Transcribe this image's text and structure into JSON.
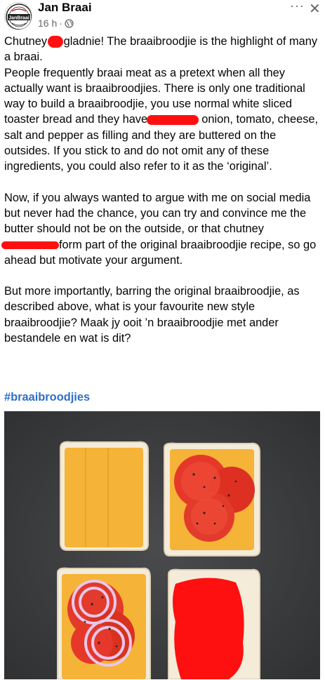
{
  "header": {
    "author": "Jan Braai",
    "time": "16 h",
    "separator": "·",
    "logo_text": "JanBraai",
    "more_icon": "more-dots-icon",
    "close_icon": "close-icon",
    "privacy_icon": "globe-icon"
  },
  "post": {
    "line1_a": "Chutney ",
    "line1_b": "gladnie! The braaibroodjie is the highlight of many a braai.",
    "line2": "People frequently braai meat as a pretext when all they actually want is braaibroodjies. There is only one traditional way to build a braaibroodjie, you use normal white sliced toaster bread and they have ",
    "line2_b": " onion, tomato, cheese, salt and pepper as filling and they are buttered on the outsides. If you stick to and do not omit any of these ingredients, you could also refer to it as the ‘original’.",
    "para2_a": "Now, if you always wanted to argue with me on social media but never had the chance, you can try and convince me the butter should not be on the outside, or that chutney ",
    "para2_b": "form part of the original braaibroodjie recipe, so go ahead but motivate your argument.",
    "para3": "But more importantly, barring the original braaibroodjie, as described above, what is your favourite new style braaibroodjie? Maak jy ooit ’n braaibroodjie met ander bestandele en wat is dit?",
    "hashtag": "#braaibroodjies"
  },
  "colors": {
    "redaction": "#ff1010",
    "link": "#2f6fca",
    "photo_background": "#3b3c3e"
  }
}
